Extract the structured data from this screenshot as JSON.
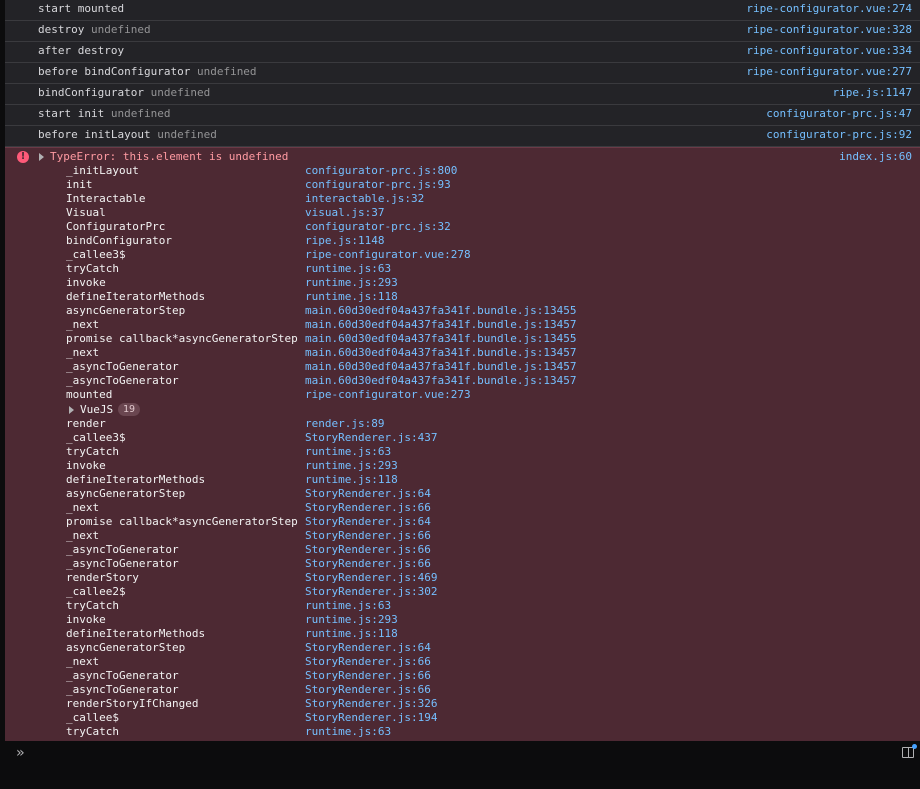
{
  "logs": [
    {
      "text": "start mounted",
      "extra": "",
      "source": "ripe-configurator.vue:274"
    },
    {
      "text": "destroy",
      "extra": "undefined",
      "source": "ripe-configurator.vue:328"
    },
    {
      "text": "after destroy",
      "extra": "",
      "source": "ripe-configurator.vue:334"
    },
    {
      "text": "before bindConfigurator",
      "extra": "undefined",
      "source": "ripe-configurator.vue:277"
    },
    {
      "text": "bindConfigurator",
      "extra": "undefined",
      "source": "ripe.js:1147"
    },
    {
      "text": "start init",
      "extra": "undefined",
      "source": "configurator-prc.js:47"
    },
    {
      "text": "before initLayout",
      "extra": "undefined",
      "source": "configurator-prc.js:92"
    }
  ],
  "error": {
    "message": "TypeError: this.element is undefined",
    "source": "index.js:60",
    "icon": "error-icon",
    "frames_before": [
      [
        "_initLayout",
        "configurator-prc.js:800"
      ],
      [
        "init",
        "configurator-prc.js:93"
      ],
      [
        "Interactable",
        "interactable.js:32"
      ],
      [
        "Visual",
        "visual.js:37"
      ],
      [
        "ConfiguratorPrc",
        "configurator-prc.js:32"
      ],
      [
        "bindConfigurator",
        "ripe.js:1148"
      ],
      [
        "_callee3$",
        "ripe-configurator.vue:278"
      ],
      [
        "tryCatch",
        "runtime.js:63"
      ],
      [
        "invoke",
        "runtime.js:293"
      ],
      [
        "defineIteratorMethods",
        "runtime.js:118"
      ],
      [
        "asyncGeneratorStep",
        "main.60d30edf04a437fa341f.bundle.js:13455"
      ],
      [
        "_next",
        "main.60d30edf04a437fa341f.bundle.js:13457"
      ],
      [
        "promise callback*asyncGeneratorStep",
        "main.60d30edf04a437fa341f.bundle.js:13455"
      ],
      [
        "_next",
        "main.60d30edf04a437fa341f.bundle.js:13457"
      ],
      [
        "_asyncToGenerator",
        "main.60d30edf04a437fa341f.bundle.js:13457"
      ],
      [
        "_asyncToGenerator",
        "main.60d30edf04a437fa341f.bundle.js:13457"
      ],
      [
        "mounted",
        "ripe-configurator.vue:273"
      ]
    ],
    "group": {
      "name": "VueJS",
      "count": "19"
    },
    "frames_after": [
      [
        "render",
        "render.js:89"
      ],
      [
        "_callee3$",
        "StoryRenderer.js:437"
      ],
      [
        "tryCatch",
        "runtime.js:63"
      ],
      [
        "invoke",
        "runtime.js:293"
      ],
      [
        "defineIteratorMethods",
        "runtime.js:118"
      ],
      [
        "asyncGeneratorStep",
        "StoryRenderer.js:64"
      ],
      [
        "_next",
        "StoryRenderer.js:66"
      ],
      [
        "promise callback*asyncGeneratorStep",
        "StoryRenderer.js:64"
      ],
      [
        "_next",
        "StoryRenderer.js:66"
      ],
      [
        "_asyncToGenerator",
        "StoryRenderer.js:66"
      ],
      [
        "_asyncToGenerator",
        "StoryRenderer.js:66"
      ],
      [
        "renderStory",
        "StoryRenderer.js:469"
      ],
      [
        "_callee2$",
        "StoryRenderer.js:302"
      ],
      [
        "tryCatch",
        "runtime.js:63"
      ],
      [
        "invoke",
        "runtime.js:293"
      ],
      [
        "defineIteratorMethods",
        "runtime.js:118"
      ],
      [
        "asyncGeneratorStep",
        "StoryRenderer.js:64"
      ],
      [
        "_next",
        "StoryRenderer.js:66"
      ],
      [
        "_asyncToGenerator",
        "StoryRenderer.js:66"
      ],
      [
        "_asyncToGenerator",
        "StoryRenderer.js:66"
      ],
      [
        "renderStoryIfChanged",
        "StoryRenderer.js:326"
      ],
      [
        "_callee$",
        "StoryRenderer.js:194"
      ],
      [
        "tryCatch",
        "runtime.js:63"
      ]
    ]
  },
  "input": {
    "prompt_icon": "chevron-double-right-icon",
    "split_icon": "split-console-icon",
    "colors": {
      "accent": "#45a1ff",
      "error_bg": "#4d2933",
      "link": "#75bfff"
    }
  }
}
